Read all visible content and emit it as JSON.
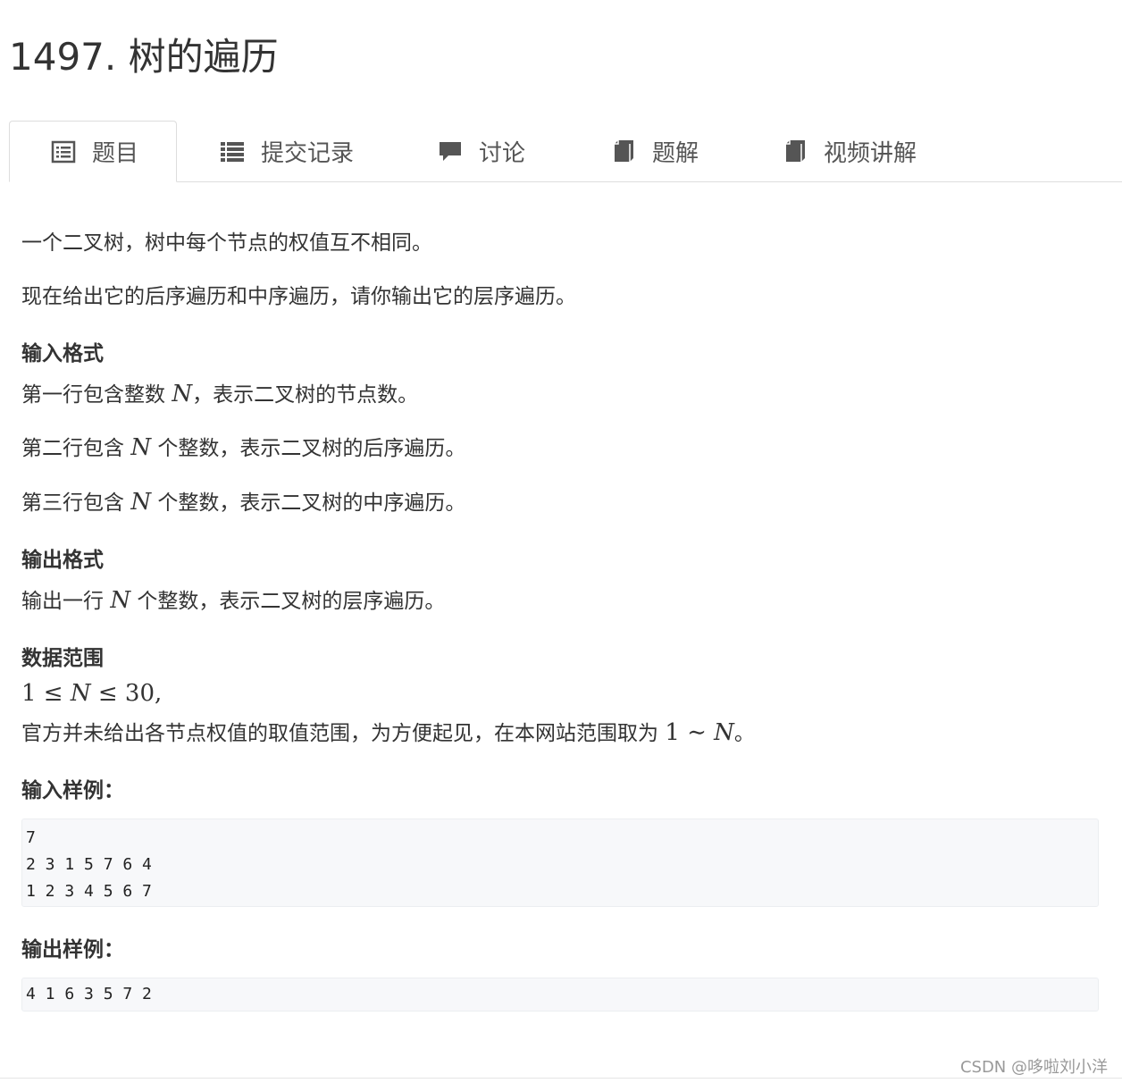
{
  "problem": {
    "title": "1497. 树的遍历"
  },
  "tabs": [
    {
      "label": "题目",
      "icon": "list-alt-icon",
      "active": true
    },
    {
      "label": "提交记录",
      "icon": "list-icon",
      "active": false
    },
    {
      "label": "讨论",
      "icon": "comment-icon",
      "active": false
    },
    {
      "label": "题解",
      "icon": "book-icon",
      "active": false
    },
    {
      "label": "视频讲解",
      "icon": "book-icon",
      "active": false
    }
  ],
  "description": {
    "line1": "一个二叉树，树中每个节点的权值互不相同。",
    "line2": "现在给出它的后序遍历和中序遍历，请你输出它的层序遍历。"
  },
  "input_format": {
    "heading": "输入格式",
    "l1_a": "第一行包含整数 ",
    "l1_var": "N",
    "l1_b": "，表示二叉树的节点数。",
    "l2_a": "第二行包含 ",
    "l2_var": "N",
    "l2_b": " 个整数，表示二叉树的后序遍历。",
    "l3_a": "第三行包含 ",
    "l3_var": "N",
    "l3_b": " 个整数，表示二叉树的中序遍历。"
  },
  "output_format": {
    "heading": "输出格式",
    "l1_a": "输出一行 ",
    "l1_var": "N",
    "l1_b": " 个整数，表示二叉树的层序遍历。"
  },
  "range": {
    "heading": "数据范围",
    "expr_1": "1 ≤ ",
    "expr_var": "N",
    "expr_2": " ≤ 30,",
    "note_a": "官方并未给出各节点权值的取值范围，为方便起见，在本网站范围取为 ",
    "note_m1": "1 ∼ ",
    "note_var": "N",
    "note_b": "。"
  },
  "sample_input": {
    "heading": "输入样例：",
    "lines": [
      "7",
      "2 3 1 5 7 6 4",
      "1 2 3 4 5 6 7"
    ]
  },
  "sample_output": {
    "heading": "输出样例：",
    "lines": [
      "4 1 6 3 5 7 2"
    ]
  },
  "watermark": "CSDN @哆啦刘小洋",
  "colors": {
    "text": "#333333",
    "tab_text": "#555555",
    "code_bg": "#f7f8fa",
    "border": "#dddddd"
  }
}
